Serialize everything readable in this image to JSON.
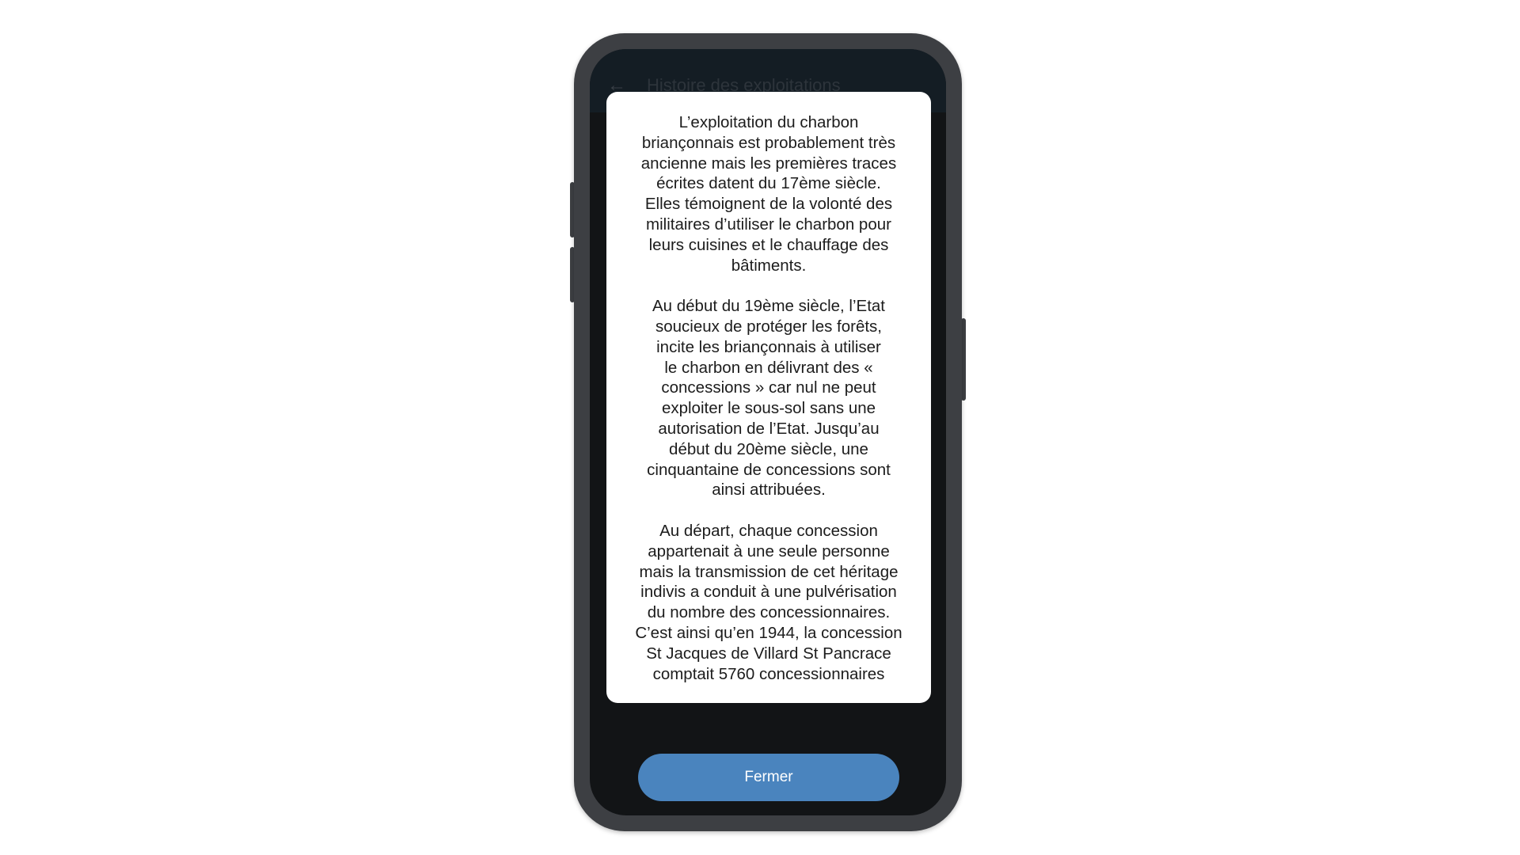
{
  "app": {
    "back_icon": "arrow-left-icon",
    "title": "Histoire des exploitations"
  },
  "dialog": {
    "paragraphs": [
      "L’exploitation du charbon\nbriançonnais est probablement très\nancienne mais les premières traces\nécrites datent du 17ème siècle.\nElles témoignent de la volonté des\nmilitaires d’utiliser le charbon pour\nleurs cuisines et le chauffage des\nbâtiments.",
      "Au début du 19ème siècle, l’Etat\nsoucieux de protéger les forêts,\nincite les briançonnais à utiliser\nle charbon en délivrant des «\nconcessions » car nul ne peut\nexploiter le sous-sol sans une\nautorisation de l’Etat. Jusqu’au\ndébut du 20ème siècle, une\ncinquantaine de concessions sont\nainsi attribuées.",
      "Au départ, chaque concession\nappartenait à une seule personne\nmais la transmission de cet héritage\nindivis a conduit à une pulvérisation\ndu nombre des concessionnaires.\nC’est ainsi qu’en 1944, la concession\nSt Jacques de Villard St Pancrace\ncomptait 5760 concessionnaires"
    ]
  },
  "close_button": {
    "label": "Fermer"
  },
  "colors": {
    "button": "#4a84be",
    "screen_background": "#121416",
    "phone_frame": "#3d3f43"
  }
}
